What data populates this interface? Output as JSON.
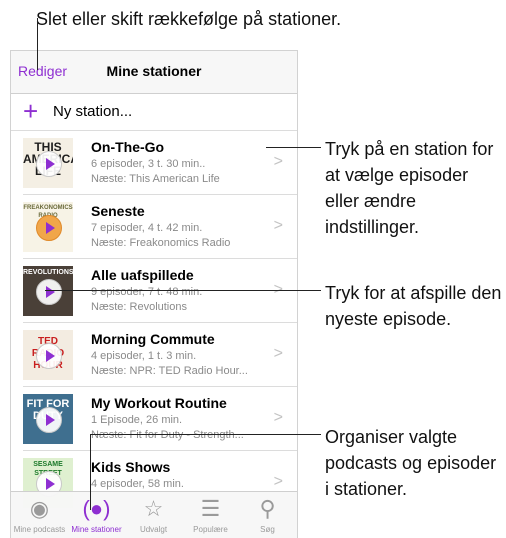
{
  "callouts": {
    "top": "Slet eller skift rækkefølge på stationer.",
    "right1": "Tryk på en station for at vælge episoder eller ændre indstillinger.",
    "right2": "Tryk for at afspille den nyeste episode.",
    "right3": "Organiser valgte podcasts og episoder i stationer."
  },
  "navbar": {
    "edit_label": "Rediger",
    "title": "Mine stationer"
  },
  "new_station": {
    "plus": "+",
    "label": "Ny station..."
  },
  "stations": [
    {
      "title": "On-The-Go",
      "sub1": "6 episoder, 3 t. 30 min..",
      "sub2": "Næste: This American Life",
      "art_label": "THIS AMERICAN LIFE"
    },
    {
      "title": "Seneste",
      "sub1": "7 episoder, 4 t. 42 min.",
      "sub2": "Næste: Freakonomics Radio",
      "art_label": "FREAKONOMICS RADIO"
    },
    {
      "title": "Alle uafspillede",
      "sub1": "9 episoder, 7 t. 48 min.",
      "sub2": "Næste: Revolutions",
      "art_label": "REVOLUTIONS"
    },
    {
      "title": "Morning Commute",
      "sub1": "4 episoder, 1 t. 3 min.",
      "sub2": "Næste: NPR: TED Radio Hour...",
      "art_label": "TED RADIO HOUR"
    },
    {
      "title": "My Workout Routine",
      "sub1": "1 Episode, 26 min.",
      "sub2": "Næste: Fit for Duty - Strength...",
      "art_label": "FIT FOR DUTY"
    },
    {
      "title": "Kids Shows",
      "sub1": "4 episoder, 58 min.",
      "sub2": "",
      "art_label": "SESAME STREET"
    }
  ],
  "tabs": [
    {
      "label": "Mine podcasts",
      "icon": "podcast-icon"
    },
    {
      "label": "Mine stationer",
      "icon": "station-icon"
    },
    {
      "label": "Udvalgt",
      "icon": "star-icon"
    },
    {
      "label": "Populære",
      "icon": "list-icon"
    },
    {
      "label": "Søg",
      "icon": "search-icon"
    }
  ],
  "colors": {
    "accent": "#8e2fd1"
  }
}
